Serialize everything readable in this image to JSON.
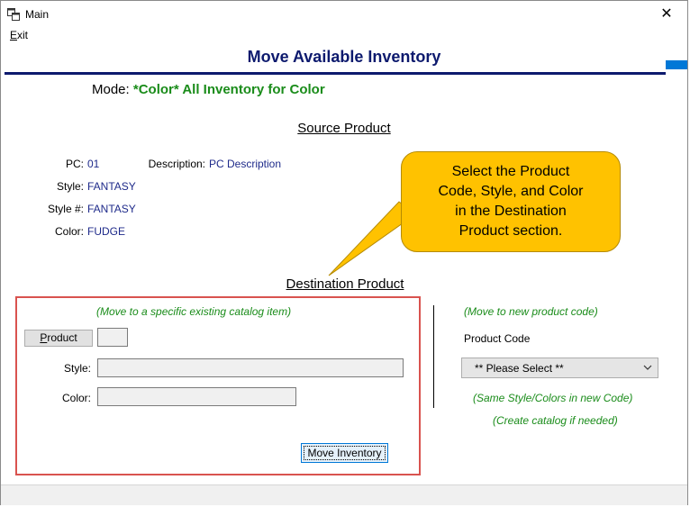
{
  "window": {
    "title": "Main",
    "close_glyph": "✕"
  },
  "menu": {
    "exit_prefix": "E",
    "exit_rest": "xit"
  },
  "header": {
    "title": "Move Available Inventory",
    "accent": "#0d1a6e"
  },
  "mode": {
    "label": "Mode:",
    "value": "*Color* All Inventory for Color",
    "color": "#1a8c1a"
  },
  "source": {
    "title": "Source Product",
    "pc_label": "PC:",
    "pc_value": "01",
    "description_label": "Description:",
    "description_value": "PC Description",
    "style_label": "Style:",
    "style_value": "FANTASY",
    "style_num_label": "Style #:",
    "style_num_value": "FANTASY",
    "color_label": "Color:",
    "color_value": "FUDGE"
  },
  "callout": {
    "lines": [
      "Select the Product",
      "Code, Style, and Color",
      "in the Destination",
      "Product section."
    ],
    "color": "#ffc200"
  },
  "destination": {
    "title": "Destination Product",
    "left": {
      "note": "(Move to a specific existing catalog item)",
      "product_button_prefix": "P",
      "product_button_rest": "roduct",
      "product_code_value": "",
      "style_label": "Style:",
      "style_value": "",
      "color_label": "Color:",
      "color_value": "",
      "move_button": "Move Inventory"
    },
    "right": {
      "note": "(Move to new product code)",
      "product_code_label": "Product Code",
      "select_value": "** Please Select **",
      "note2": "(Same Style/Colors in new Code)",
      "note3": "(Create catalog if needed)"
    }
  },
  "icons": {
    "app": "window-icon",
    "dropdown": "chevron-down-icon",
    "close": "close-icon"
  }
}
